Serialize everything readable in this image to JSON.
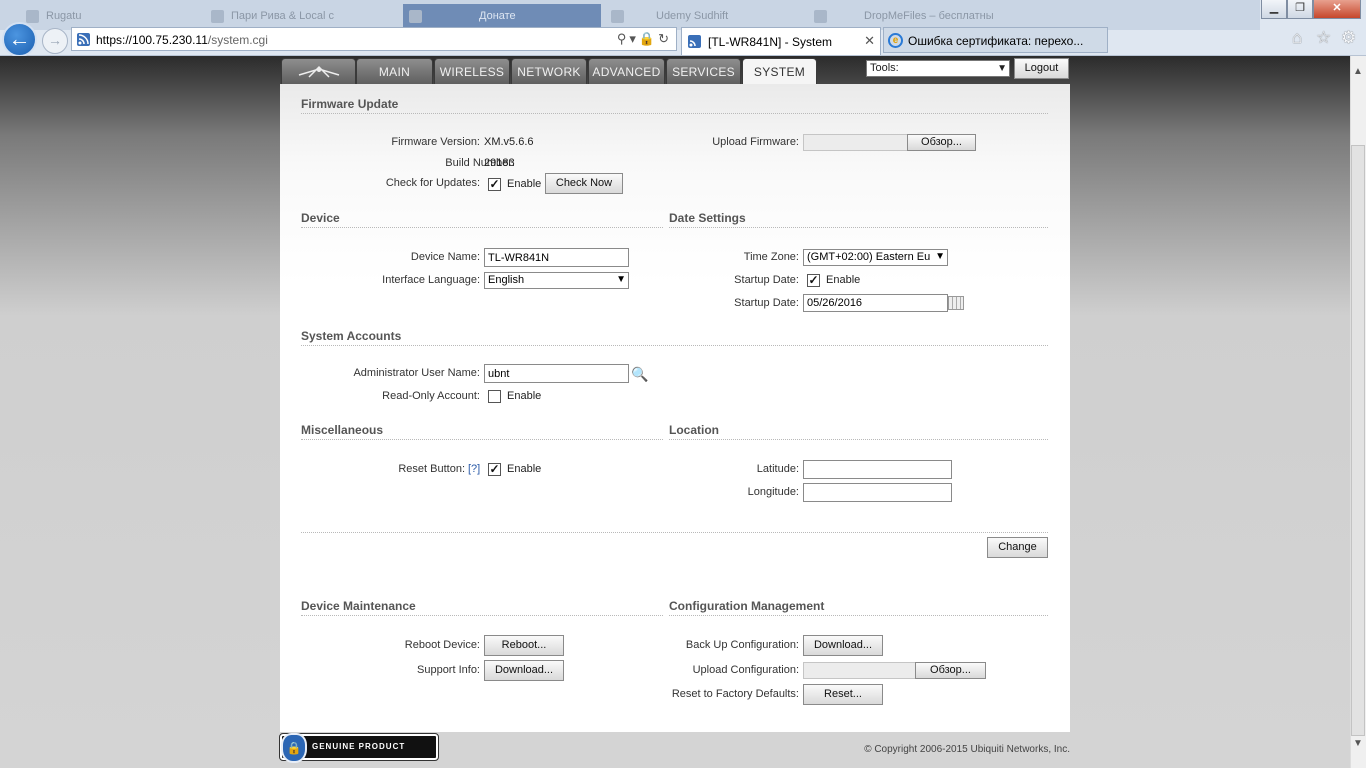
{
  "browser": {
    "faint_tabs": [
      "Rugatu",
      "Пари Рива & Local с",
      "Донате",
      "Udemy Sudhift",
      "DropMeFiles – бесплатны"
    ],
    "url_host": "https://100.75.230.11",
    "url_path": "/system.cgi",
    "active_tab_title": "[TL-WR841N] - System",
    "other_tab_title": "Ошибка сертификата: перехо...",
    "window_controls": [
      "minimize",
      "restore",
      "close"
    ],
    "toolbar_icons": [
      "home-icon",
      "star-icon",
      "gear-icon"
    ]
  },
  "nav": {
    "tabs": [
      "MAIN",
      "WIRELESS",
      "NETWORK",
      "ADVANCED",
      "SERVICES",
      "SYSTEM"
    ],
    "active": "SYSTEM",
    "tools_label": "Tools:",
    "logout_label": "Logout"
  },
  "firmware": {
    "title": "Firmware Update",
    "version_label": "Firmware Version:",
    "version_value": "XM.v5.6.6",
    "build_label": "Build Number:",
    "build_value": "29183",
    "check_label": "Check for Updates:",
    "check_enable": "Enable",
    "check_now": "Check Now",
    "upload_label": "Upload Firmware:",
    "browse_label": "Обзор..."
  },
  "device": {
    "title": "Device",
    "name_label": "Device Name:",
    "name_value": "TL-WR841N",
    "lang_label": "Interface Language:",
    "lang_value": "English"
  },
  "date": {
    "title": "Date Settings",
    "tz_label": "Time Zone:",
    "tz_value": "(GMT+02:00) Eastern Eu",
    "startup_label": "Startup Date:",
    "startup_enable": "Enable",
    "startup_date_label": "Startup Date:",
    "startup_date_value": "05/26/2016"
  },
  "accounts": {
    "title": "System Accounts",
    "admin_label": "Administrator User Name:",
    "admin_value": "ubnt",
    "readonly_label": "Read-Only Account:",
    "readonly_enable": "Enable"
  },
  "misc": {
    "title": "Miscellaneous",
    "reset_label": "Reset Button:",
    "help": "[?]",
    "reset_enable": "Enable"
  },
  "location": {
    "title": "Location",
    "lat_label": "Latitude:",
    "lat_value": "",
    "lon_label": "Longitude:",
    "lon_value": ""
  },
  "change_label": "Change",
  "maintenance": {
    "title": "Device Maintenance",
    "reboot_label": "Reboot Device:",
    "reboot_button": "Reboot...",
    "support_label": "Support Info:",
    "support_button": "Download..."
  },
  "config": {
    "title": "Configuration Management",
    "backup_label": "Back Up Configuration:",
    "backup_button": "Download...",
    "upload_label": "Upload Configuration:",
    "browse_label": "Обзор...",
    "reset_label": "Reset to Factory Defaults:",
    "reset_button": "Reset..."
  },
  "footer": {
    "badge": "GENUINE PRODUCT",
    "copyright": "© Copyright 2006-2015 Ubiquiti Networks, Inc."
  }
}
